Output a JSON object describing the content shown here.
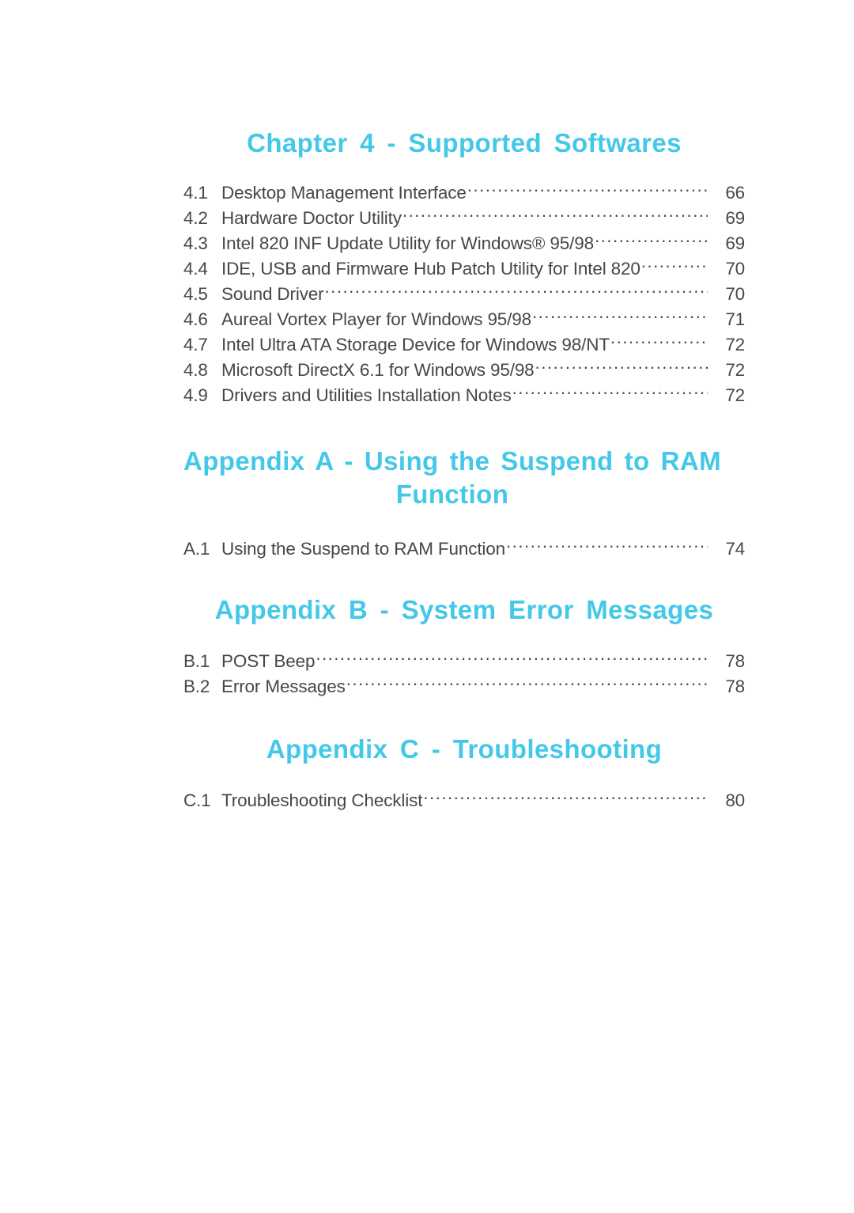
{
  "document": {
    "type": "table-of-contents",
    "page_background": "#ffffff",
    "heading_color": "#44c8e8",
    "body_text_color": "#4b4449"
  },
  "sections": [
    {
      "heading": "Chapter  4 - Supported  Softwares",
      "heading_lines": [
        "Chapter  4 - Supported  Softwares"
      ],
      "entries": [
        {
          "num": "4.1",
          "title": "Desktop Management Interface",
          "page": "66"
        },
        {
          "num": "4.2",
          "title": "Hardware Doctor Utility",
          "page": "69"
        },
        {
          "num": "4.3",
          "title": "Intel 820 INF Update Utility for Windows® 95/98",
          "page": "69"
        },
        {
          "num": "4.4",
          "title": "IDE, USB and Firmware Hub Patch Utility for Intel 820",
          "page": "70"
        },
        {
          "num": "4.5",
          "title": "Sound Driver",
          "page": "70"
        },
        {
          "num": "4.6",
          "title": "Aureal Vortex Player for Windows 95/98",
          "page": "71"
        },
        {
          "num": "4.7",
          "title": "Intel Ultra ATA Storage Device for Windows 98/NT",
          "page": "72"
        },
        {
          "num": "4.8",
          "title": "Microsoft DirectX 6.1 for Windows 95/98",
          "page": "72"
        },
        {
          "num": "4.9",
          "title": "Drivers and Utilities Installation Notes",
          "page": "72"
        }
      ]
    },
    {
      "heading": "Appendix A - Using the Suspend to RAM Function",
      "heading_lines": [
        "Appendix A - Using  the  Suspend  to  RAM",
        "Function"
      ],
      "entries": [
        {
          "num": "A.1",
          "title": "Using the Suspend to RAM Function",
          "page": "74"
        }
      ]
    },
    {
      "heading": "Appendix  B - System  Error  Messages",
      "heading_lines": [
        "Appendix  B - System  Error  Messages"
      ],
      "entries": [
        {
          "num": "B.1",
          "title": "POST Beep",
          "page": "78"
        },
        {
          "num": "B.2",
          "title": "Error Messages",
          "page": "78"
        }
      ]
    },
    {
      "heading": "Appendix  C - Troubleshooting",
      "heading_lines": [
        "Appendix  C - Troubleshooting"
      ],
      "entries": [
        {
          "num": "C.1",
          "title": "Troubleshooting Checklist",
          "page": "80"
        }
      ]
    }
  ]
}
